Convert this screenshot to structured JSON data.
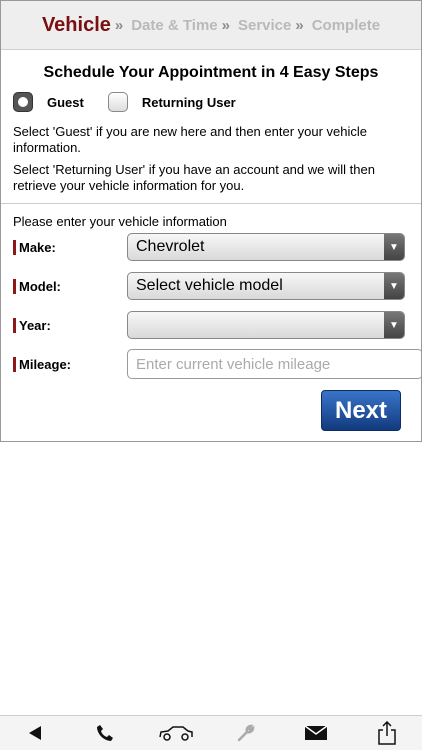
{
  "steps": {
    "active": "Vehicle",
    "sep": "»",
    "items": [
      "Date & Time",
      "Service",
      "Complete"
    ]
  },
  "title": "Schedule Your Appointment in 4 Easy Steps",
  "radios": {
    "guest": "Guest",
    "returning": "Returning User",
    "selected": "guest"
  },
  "info": {
    "guest": "Select 'Guest' if you are new here and then enter your vehicle information.",
    "returning": "Select 'Returning User' if you have an account and we will then retrieve your vehicle information for you."
  },
  "form": {
    "prompt": "Please enter your vehicle information",
    "make_label": "Make:",
    "make_value": "Chevrolet",
    "model_label": "Model:",
    "model_value": "Select vehicle model",
    "year_label": "Year:",
    "year_value": "",
    "mileage_label": "Mileage:",
    "mileage_placeholder": "Enter current vehicle mileage"
  },
  "next_label": "Next",
  "toolbar": [
    "back-icon",
    "phone-icon",
    "car-icon",
    "wrench-icon",
    "mail-icon",
    "share-icon"
  ]
}
